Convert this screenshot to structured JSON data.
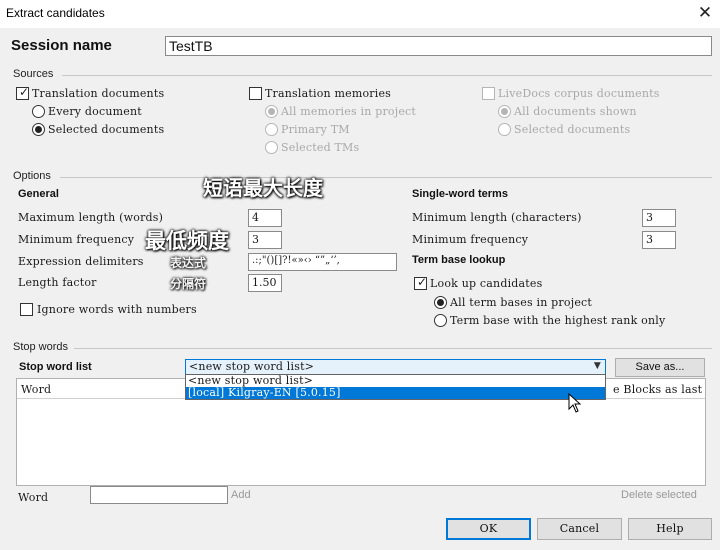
{
  "window": {
    "title": "Extract candidates",
    "close_glyph": "✕"
  },
  "session": {
    "label": "Session name",
    "value": "TestTB"
  },
  "sources": {
    "group_label": "Sources",
    "translation_documents": {
      "label": "Translation documents",
      "checked": true
    },
    "every_document": "Every document",
    "selected_documents": "Selected documents",
    "translation_memories": {
      "label": "Translation memories",
      "checked": false
    },
    "all_memories": "All memories in project",
    "primary_tm": "Primary TM",
    "selected_tms": "Selected TMs",
    "livedocs": {
      "label": "LiveDocs corpus documents",
      "checked": false
    },
    "all_documents_shown": "All documents shown",
    "livedocs_selected_documents": "Selected documents"
  },
  "options": {
    "group_label": "Options",
    "general_heading": "General",
    "max_length_label": "Maximum length (words)",
    "max_length_value": "4",
    "min_frequency_label": "Minimum frequency",
    "min_frequency_value": "3",
    "expression_delimiters_label": "Expression delimiters",
    "expression_delimiters_value": ".:;\"()[]?!«»‹› “”„‘’,",
    "length_factor_label": "Length factor",
    "length_factor_value": "1.50",
    "ignore_numbers_label": "Ignore words with numbers",
    "single_word_heading": "Single-word terms",
    "min_length_chars_label": "Minimum length (characters)",
    "min_length_chars_value": "3",
    "sw_min_frequency_label": "Minimum frequency",
    "sw_min_frequency_value": "3",
    "term_base_lookup_heading": "Term base lookup",
    "look_up_candidates": {
      "label": "Look up candidates",
      "checked": true
    },
    "all_term_bases": "All term bases in project",
    "highest_rank": "Term base with the highest rank only"
  },
  "annotations": {
    "max_phrase_length": "短语最大长度",
    "min_frequency": "最低频度",
    "expression": "表达式",
    "delimiter": "分隔符"
  },
  "stop_words": {
    "group_label": "Stop words",
    "list_label": "Stop word list",
    "selected_value": "<new stop word list>",
    "dropdown_options": [
      "<new stop word list>",
      "[local] Kilgray-EN [5.0.15]"
    ],
    "save_as": "Save as...",
    "column_word": "Word",
    "column_right": "e Blocks as last",
    "word_label": "Word",
    "add_label": "Add",
    "delete_selected": "Delete selected"
  },
  "footer": {
    "ok": "OK",
    "cancel": "Cancel",
    "help": "Help"
  },
  "colors": {
    "accent": "#0078d7",
    "selection": "#0078d7",
    "background": "#f0f0f0"
  }
}
